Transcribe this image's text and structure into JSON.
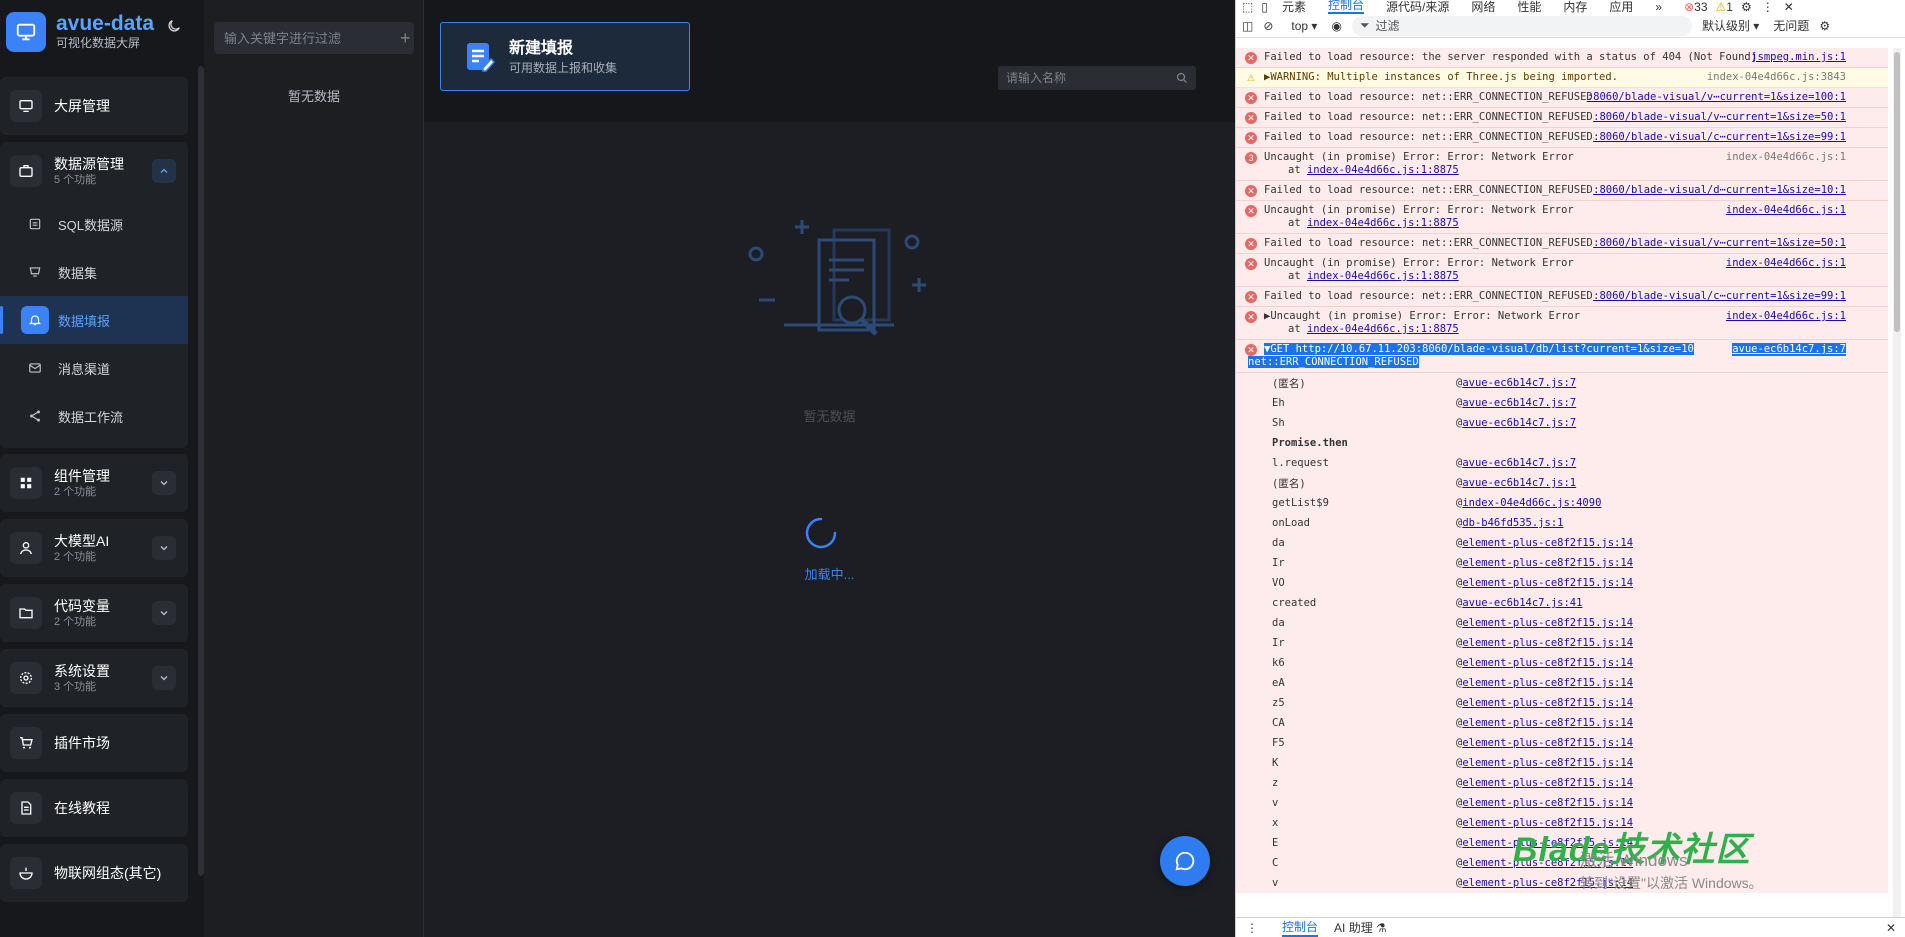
{
  "sidebar": {
    "logo_title": "avue-data",
    "logo_subtitle": "可视化数据大屏",
    "groups": [
      {
        "label": "大屏管理"
      },
      {
        "label": "数据源管理",
        "count": "5 个功能",
        "items": [
          {
            "label": "SQL数据源"
          },
          {
            "label": "数据集"
          },
          {
            "label": "数据填报"
          },
          {
            "label": "消息渠道"
          },
          {
            "label": "数据工作流"
          }
        ]
      },
      {
        "label": "组件管理",
        "count": "2 个功能"
      },
      {
        "label": "大模型AI",
        "count": "2 个功能"
      },
      {
        "label": "代码变量",
        "count": "2 个功能"
      },
      {
        "label": "系统设置",
        "count": "3 个功能"
      },
      {
        "label": "插件市场"
      },
      {
        "label": "在线教程"
      },
      {
        "label": "物联网组态(其它)"
      }
    ]
  },
  "midpanel": {
    "search_placeholder": "输入关键字进行过滤",
    "empty_text": "暂无数据"
  },
  "content": {
    "new_card_title": "新建填报",
    "new_card_subtitle": "可用数据上报和收集",
    "name_placeholder": "请输入名称",
    "empty_text": "暂无数据",
    "loading_text": "加载中..."
  },
  "devtools": {
    "tabs": [
      "元素",
      "控制台",
      "源代码/来源",
      "网络",
      "性能",
      "内存",
      "应用"
    ],
    "error_count": "33",
    "warn_count": "1",
    "context": "top ▾",
    "filter_placeholder": "过滤",
    "level": "默认级别 ▾",
    "issues": "无问题",
    "messages": [
      {
        "type": "error",
        "text": "Failed to load resource: the server responded with a status of 404 (Not Found)",
        "src": "jsmpeg.min.js:1"
      },
      {
        "type": "warn",
        "text": "▶WARNING: Multiple instances of Three.js being imported.",
        "src": "index-04e4d66c.js:3843"
      },
      {
        "type": "error",
        "text": "Failed to load resource: net::ERR_CONNECTION_REFUSED",
        "src": ":8060/blade-visual/v⋯current=1&size=100:1"
      },
      {
        "type": "error",
        "text": "Failed to load resource: net::ERR_CONNECTION_REFUSED",
        "src": ":8060/blade-visual/v⋯current=1&size=50:1"
      },
      {
        "type": "error",
        "text": "Failed to load resource: net::ERR_CONNECTION_REFUSED",
        "src": ":8060/blade-visual/c⋯current=1&size=99:1"
      },
      {
        "type": "error",
        "count": "3",
        "text": "Uncaught (in promise) Error: Error: Network Error",
        "at": "index-04e4d66c.js:1:8875",
        "src": "index-04e4d66c.js:1",
        "plain": true
      },
      {
        "type": "error",
        "text": "Failed to load resource: net::ERR_CONNECTION_REFUSED",
        "src": ":8060/blade-visual/d⋯current=1&size=10:1"
      },
      {
        "type": "error",
        "text": "Uncaught (in promise) Error: Error: Network Error",
        "at": "index-04e4d66c.js:1:8875",
        "src": "index-04e4d66c.js:1"
      },
      {
        "type": "error",
        "text": "Failed to load resource: net::ERR_CONNECTION_REFUSED",
        "src": ":8060/blade-visual/v⋯current=1&size=50:1"
      },
      {
        "type": "error",
        "text": "Uncaught (in promise) Error: Error: Network Error",
        "at": "index-04e4d66c.js:1:8875",
        "src": "index-04e4d66c.js:1"
      },
      {
        "type": "error",
        "text": "Failed to load resource: net::ERR_CONNECTION_REFUSED",
        "src": ":8060/blade-visual/c⋯current=1&size=99:1"
      },
      {
        "type": "error",
        "text": "▶Uncaught (in promise) Error: Error: Network Error",
        "at": "index-04e4d66c.js:1:8875",
        "src": "index-04e4d66c.js:1"
      }
    ],
    "selected": {
      "line1": "▼GET http://10.67.11.203:8060/blade-visual/db/list?current=1&size=10",
      "line2": "net::ERR_CONNECTION_REFUSED",
      "src": "avue-ec6b14c7.js:7"
    },
    "stack": [
      {
        "fn": "(匿名)",
        "loc": "avue-ec6b14c7.js:7"
      },
      {
        "fn": "Eh",
        "loc": "avue-ec6b14c7.js:7"
      },
      {
        "fn": "Sh",
        "loc": "avue-ec6b14c7.js:7"
      },
      {
        "fn": "Promise.then",
        "loc": "",
        "bold": true
      },
      {
        "fn": "l.request",
        "loc": "avue-ec6b14c7.js:7"
      },
      {
        "fn": "(匿名)",
        "loc": "avue-ec6b14c7.js:1"
      },
      {
        "fn": "getList$9",
        "loc": "index-04e4d66c.js:4090"
      },
      {
        "fn": "onLoad",
        "loc": "db-b46fd535.js:1"
      },
      {
        "fn": "da",
        "loc": "element-plus-ce8f2f15.js:14"
      },
      {
        "fn": "Ir",
        "loc": "element-plus-ce8f2f15.js:14"
      },
      {
        "fn": "VO",
        "loc": "element-plus-ce8f2f15.js:14"
      },
      {
        "fn": "created",
        "loc": "avue-ec6b14c7.js:41"
      },
      {
        "fn": "da",
        "loc": "element-plus-ce8f2f15.js:14"
      },
      {
        "fn": "Ir",
        "loc": "element-plus-ce8f2f15.js:14"
      },
      {
        "fn": "k6",
        "loc": "element-plus-ce8f2f15.js:14"
      },
      {
        "fn": "eA",
        "loc": "element-plus-ce8f2f15.js:14"
      },
      {
        "fn": "z5",
        "loc": "element-plus-ce8f2f15.js:14"
      },
      {
        "fn": "CA",
        "loc": "element-plus-ce8f2f15.js:14"
      },
      {
        "fn": "F5",
        "loc": "element-plus-ce8f2f15.js:14"
      },
      {
        "fn": "K",
        "loc": "element-plus-ce8f2f15.js:14"
      },
      {
        "fn": "z",
        "loc": "element-plus-ce8f2f15.js:14"
      },
      {
        "fn": "v",
        "loc": "element-plus-ce8f2f15.js:14"
      },
      {
        "fn": "x",
        "loc": "element-plus-ce8f2f15.js:14"
      },
      {
        "fn": "E",
        "loc": "element-plus-ce8f2f15.js:14"
      },
      {
        "fn": "C",
        "loc": "element-plus-ce8f2f15.js:14"
      },
      {
        "fn": "v",
        "loc": "element-plus-ce8f2f15.js:14"
      }
    ],
    "drawer_tabs": [
      "控制台",
      "AI 助理 ⚗"
    ]
  },
  "overlay": {
    "watermark": "Blade技术社区",
    "activate_line1": "激活 Windows",
    "activate_line2": "转到\"设置\"以激活 Windows。"
  },
  "colors": {
    "accent": "#3b82f6",
    "error_bg": "#fdeceb",
    "warn_bg": "#fffbe5",
    "watermark": "#2fb04a"
  }
}
